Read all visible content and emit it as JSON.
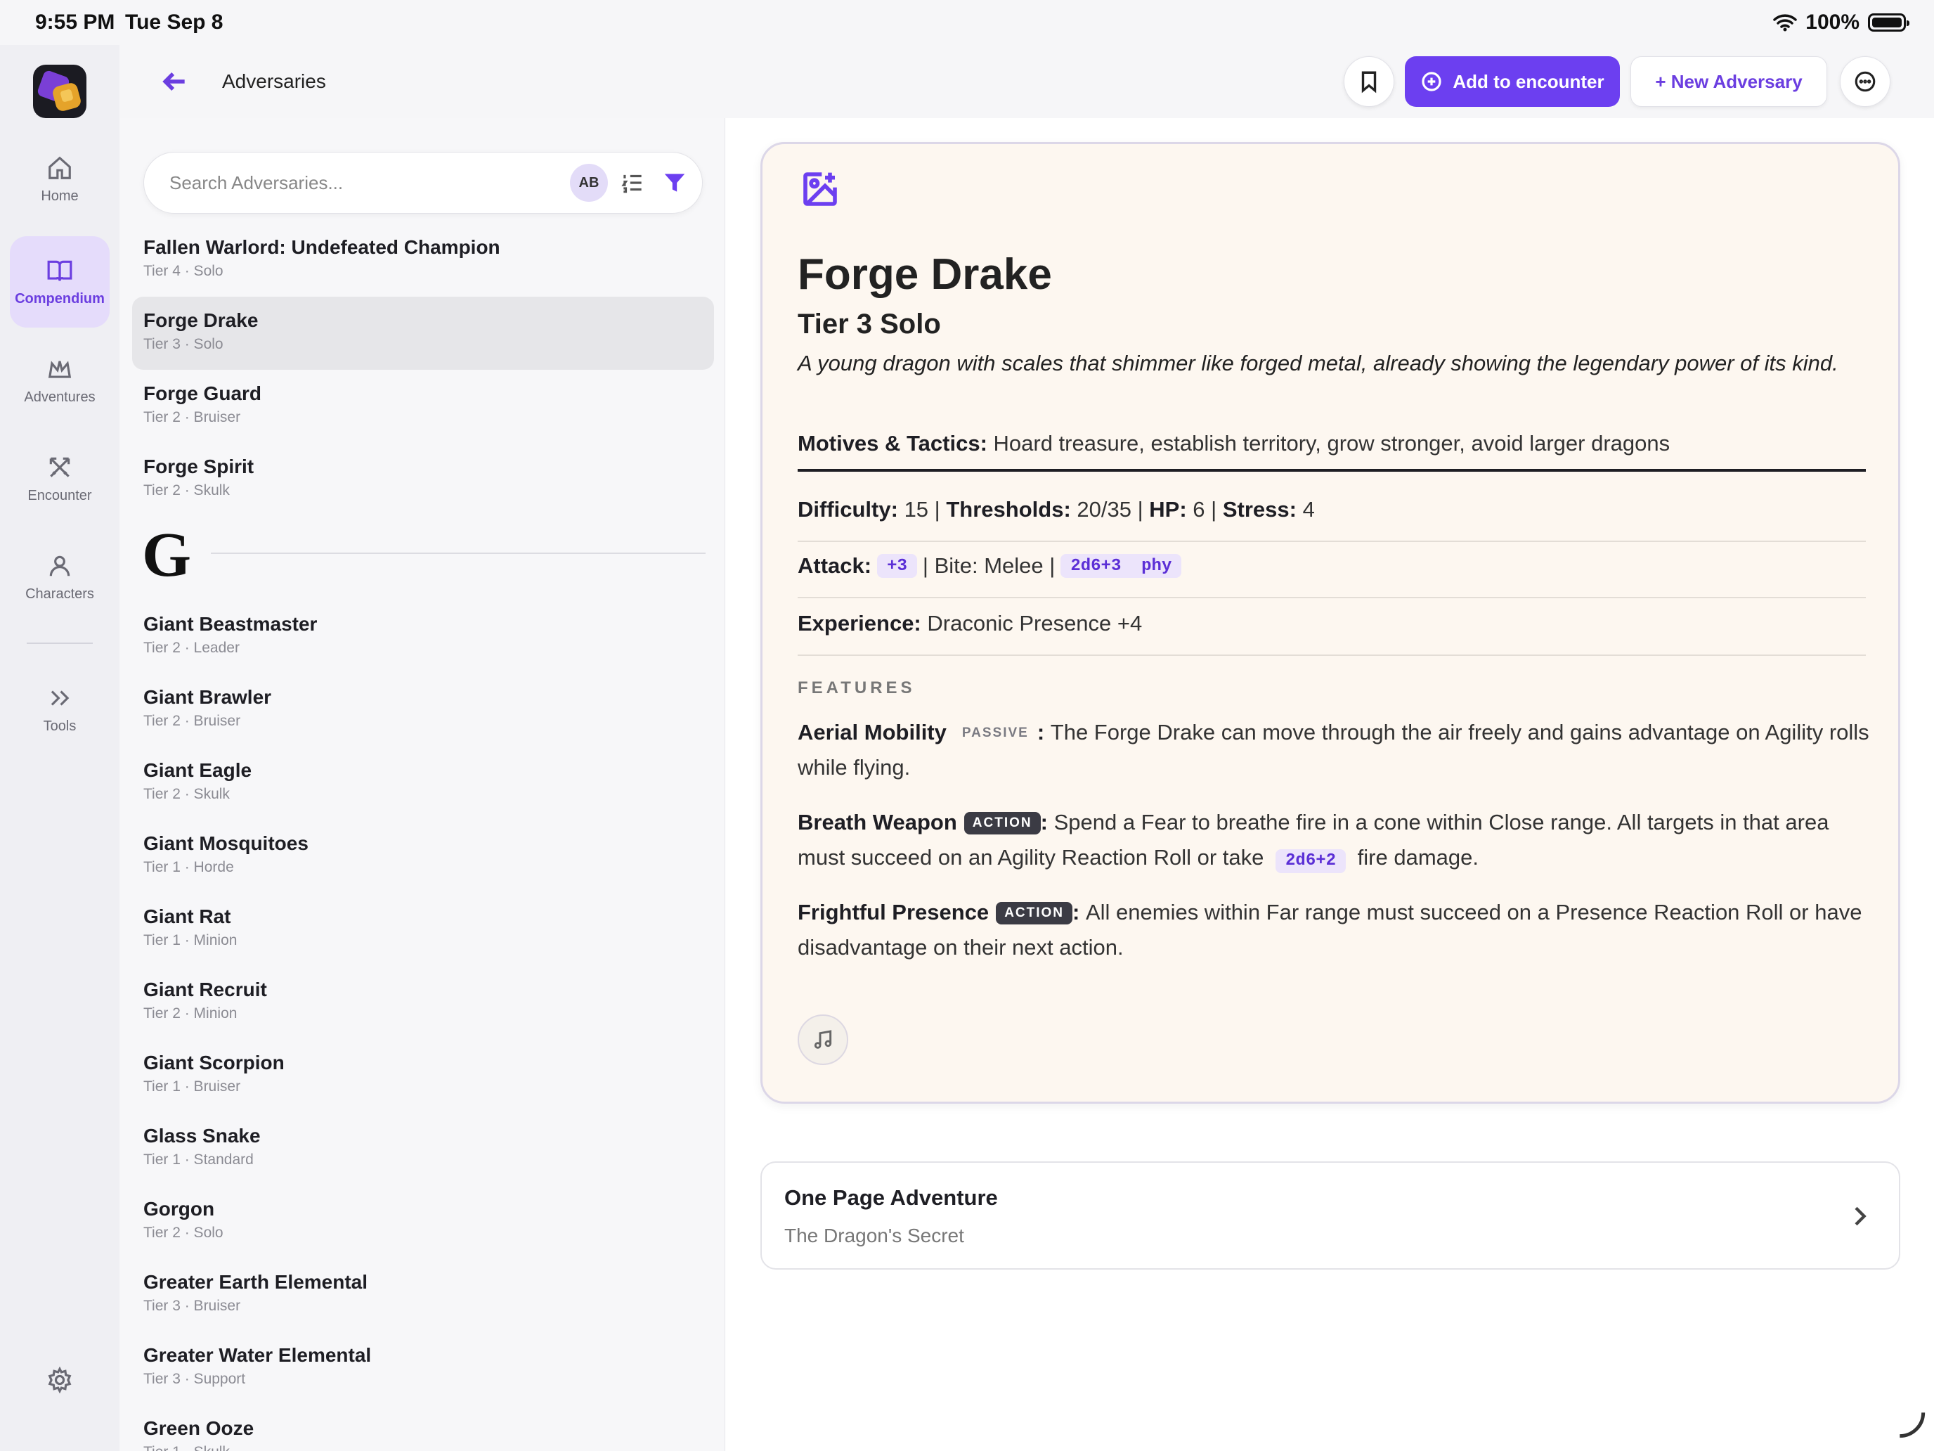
{
  "status_bar": {
    "time": "9:55 PM",
    "date": "Tue Sep 8",
    "battery": "100%"
  },
  "nav": {
    "items": [
      {
        "label": "Home",
        "icon": "home-icon"
      },
      {
        "label": "Compendium",
        "icon": "book-icon",
        "active": true
      },
      {
        "label": "Adventures",
        "icon": "crown-icon"
      },
      {
        "label": "Encounter",
        "icon": "crossed-swords-icon"
      },
      {
        "label": "Characters",
        "icon": "person-icon"
      },
      {
        "label": "Tools",
        "icon": "double-chevron-icon"
      }
    ],
    "settings_icon": "gear-icon"
  },
  "header": {
    "title": "Adversaries",
    "add_to_encounter": "Add to encounter",
    "new_adversary": "+ New Adversary"
  },
  "search": {
    "placeholder": "Search Adversaries...",
    "sort_badge": "AB"
  },
  "list": {
    "items_f": [
      {
        "name": "Fallen Warlord: Undefeated Champion",
        "sub": "Tier 4 · Solo"
      },
      {
        "name": "Forge Drake",
        "sub": "Tier 3 · Solo",
        "selected": true
      },
      {
        "name": "Forge Guard",
        "sub": "Tier 2 · Bruiser"
      },
      {
        "name": "Forge Spirit",
        "sub": "Tier 2 · Skulk"
      }
    ],
    "section_letter": "G",
    "items_g": [
      {
        "name": "Giant Beastmaster",
        "sub": "Tier 2 · Leader"
      },
      {
        "name": "Giant Brawler",
        "sub": "Tier 2 · Bruiser"
      },
      {
        "name": "Giant Eagle",
        "sub": "Tier 2 · Skulk"
      },
      {
        "name": "Giant Mosquitoes",
        "sub": "Tier 1 · Horde"
      },
      {
        "name": "Giant Rat",
        "sub": "Tier 1 · Minion"
      },
      {
        "name": "Giant Recruit",
        "sub": "Tier 2 · Minion"
      },
      {
        "name": "Giant Scorpion",
        "sub": "Tier 1 · Bruiser"
      },
      {
        "name": "Glass Snake",
        "sub": "Tier 1 · Standard"
      },
      {
        "name": "Gorgon",
        "sub": "Tier 2 · Solo"
      },
      {
        "name": "Greater Earth Elemental",
        "sub": "Tier 3 · Bruiser"
      },
      {
        "name": "Greater Water Elemental",
        "sub": "Tier 3 · Support"
      },
      {
        "name": "Green Ooze",
        "sub": "Tier 1 · Skulk"
      }
    ]
  },
  "adversary": {
    "name": "Forge Drake",
    "tier": "Tier 3 Solo",
    "description": "A young dragon with scales that shimmer like forged metal, already showing the legendary power of its kind.",
    "motives_label": "Motives & Tactics:",
    "motives": "Hoard treasure, establish territory, grow stronger, avoid larger dragons",
    "difficulty_label": "Difficulty:",
    "difficulty": "15",
    "thresholds_label": "Thresholds:",
    "thresholds": "20/35",
    "hp_label": "HP:",
    "hp": "6",
    "stress_label": "Stress:",
    "stress": "4",
    "separator": "|",
    "attack_label": "Attack:",
    "attack_mod": "+3",
    "attack_desc": "| Bite: Melee |",
    "attack_damage": "2d6+3  phy",
    "experience_label": "Experience:",
    "experience": "Draconic Presence +4",
    "features_label": "FEATURES",
    "features": [
      {
        "name": "Aerial Mobility",
        "tag": "PASSIVE",
        "text": "The Forge Drake can move through the air freely and gains advantage on Agility rolls while flying."
      },
      {
        "name": "Breath Weapon",
        "tag": "ACTION",
        "text_before": "Spend a Fear to breathe fire in a cone within Close range. All targets in that area must succeed on an Agility Reaction Roll or take",
        "damage": "2d6+2",
        "text_after": "fire damage."
      },
      {
        "name": "Frightful Presence",
        "tag": "ACTION",
        "text": "All enemies within Far range must succeed on a Presence Reaction Roll or have disadvantage on their next action."
      }
    ]
  },
  "adventure_card": {
    "title": "One Page Adventure",
    "subtitle": "The Dragon's Secret"
  },
  "colors": {
    "accent": "#6c3ff0",
    "card_bg": "#fdf7f0",
    "chip_bg": "#ece4fb"
  }
}
